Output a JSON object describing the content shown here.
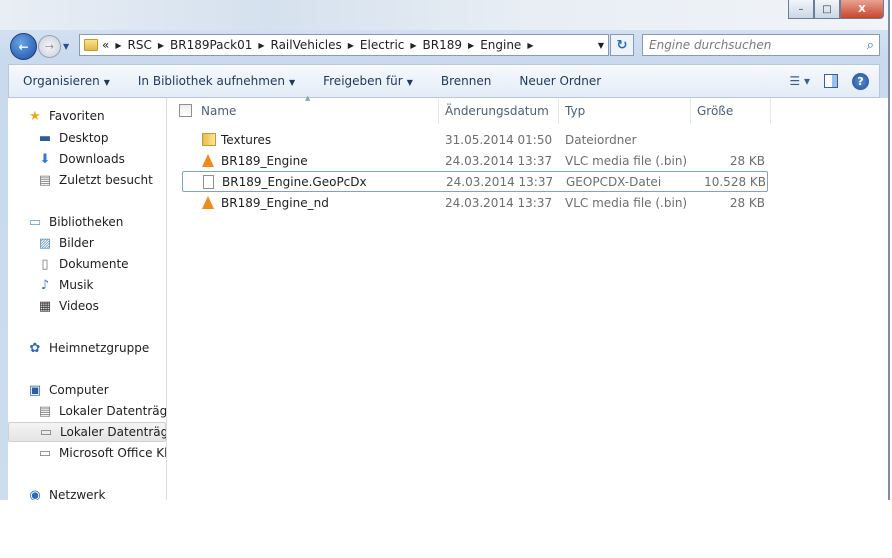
{
  "window": {
    "minimize": "–",
    "maximize": "□",
    "close": "X"
  },
  "address": {
    "overflow": "«",
    "crumbs": [
      "RSC",
      "BR189Pack01",
      "RailVehicles",
      "Electric",
      "BR189",
      "Engine"
    ]
  },
  "search": {
    "placeholder": "Engine durchsuchen"
  },
  "toolbar": {
    "organize": "Organisieren",
    "library": "In Bibliothek aufnehmen",
    "share": "Freigeben für",
    "burn": "Brennen",
    "new_folder": "Neuer Ordner"
  },
  "sidebar": {
    "items": [
      {
        "label": "Favoriten",
        "icon": "star-icon",
        "level": 0
      },
      {
        "label": "Desktop",
        "icon": "desktop-icon",
        "level": 1
      },
      {
        "label": "Downloads",
        "icon": "downloads-icon",
        "level": 1
      },
      {
        "label": "Zuletzt besucht",
        "icon": "recent-places-icon",
        "level": 1
      },
      {
        "label": "Bibliotheken",
        "icon": "libraries-icon",
        "level": 0
      },
      {
        "label": "Bilder",
        "icon": "pictures-icon",
        "level": 1
      },
      {
        "label": "Dokumente",
        "icon": "documents-icon",
        "level": 1
      },
      {
        "label": "Musik",
        "icon": "music-icon",
        "level": 1
      },
      {
        "label": "Videos",
        "icon": "videos-icon",
        "level": 1
      },
      {
        "label": "Heimnetzgruppe",
        "icon": "homegroup-icon",
        "level": 0
      },
      {
        "label": "Computer",
        "icon": "computer-icon",
        "level": 0
      },
      {
        "label": "Lokaler Datenträger",
        "icon": "system-drive-icon",
        "level": 1
      },
      {
        "label": "Lokaler Datenträger",
        "icon": "drive-icon",
        "level": 1,
        "selected": true
      },
      {
        "label": "Microsoft Office Klick",
        "icon": "drive-icon",
        "level": 1
      },
      {
        "label": "Netzwerk",
        "icon": "network-icon",
        "level": 0
      }
    ]
  },
  "columns": {
    "name": "Name",
    "date": "Änderungsdatum",
    "type": "Typ",
    "size": "Größe"
  },
  "files": [
    {
      "name": "Textures",
      "date": "31.05.2014 01:50",
      "type": "Dateiordner",
      "size": "",
      "icon": "folder-icon"
    },
    {
      "name": "BR189_Engine",
      "date": "24.03.2014 13:37",
      "type": "VLC media file (.bin)",
      "size": "28 KB",
      "icon": "vlc-icon"
    },
    {
      "name": "BR189_Engine.GeoPcDx",
      "date": "24.03.2014 13:37",
      "type": "GEOPCDX-Datei",
      "size": "10.528 KB",
      "icon": "file-icon",
      "focused": true
    },
    {
      "name": "BR189_Engine_nd",
      "date": "24.03.2014 13:37",
      "type": "VLC media file (.bin)",
      "size": "28 KB",
      "icon": "vlc-icon"
    }
  ]
}
